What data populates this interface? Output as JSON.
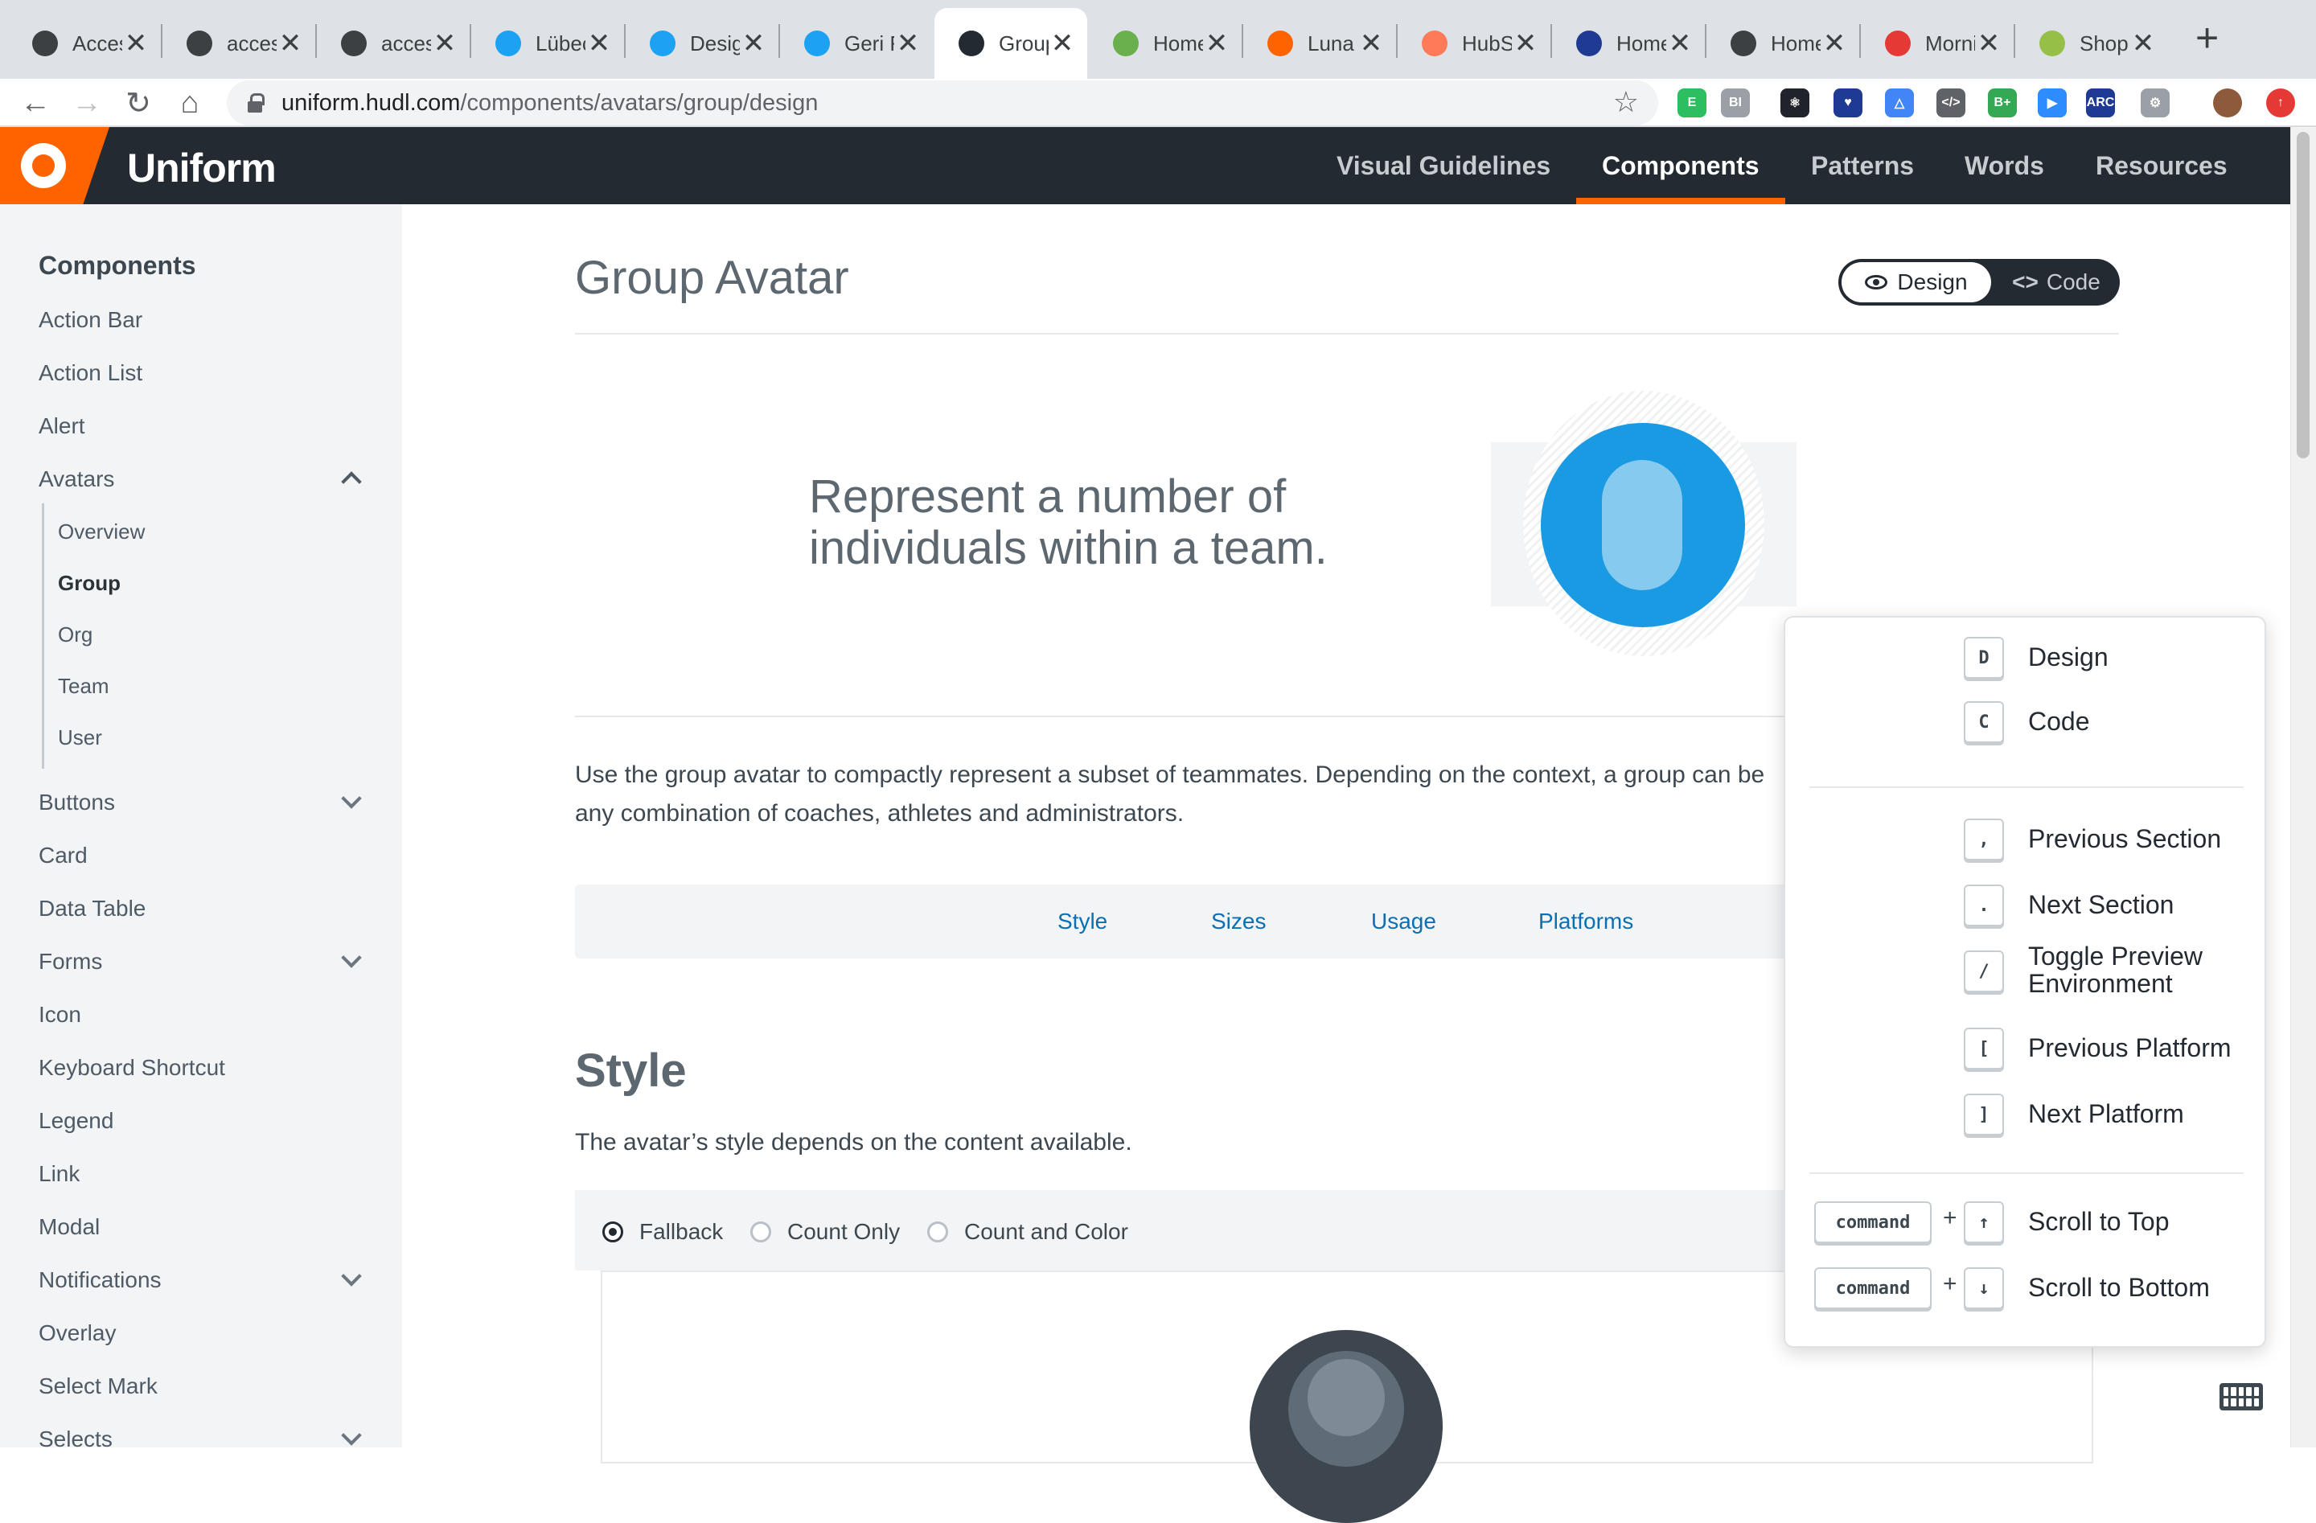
{
  "browser": {
    "tabs": [
      {
        "title": "Accessibility",
        "icon": "globe-icon",
        "color": "#3c4043"
      },
      {
        "title": "accessibility",
        "icon": "globe-icon",
        "color": "#3c4043"
      },
      {
        "title": "accessibility",
        "icon": "globe-icon",
        "color": "#3c4043"
      },
      {
        "title": "Lübeck",
        "icon": "twitter-icon",
        "color": "#1da1f2"
      },
      {
        "title": "Design",
        "icon": "twitter-icon",
        "color": "#1da1f2"
      },
      {
        "title": "Geri R",
        "icon": "twitter-icon",
        "color": "#1da1f2"
      },
      {
        "title": "Group",
        "icon": "uniform-icon",
        "color": "#232a31"
      },
      {
        "title": "Home",
        "icon": "hudl-icon",
        "color": "#6ab04c"
      },
      {
        "title": "Luna",
        "icon": "s-icon",
        "color": "#ff6300"
      },
      {
        "title": "HubSpot",
        "icon": "hubspot-icon",
        "color": "#ff7a59"
      },
      {
        "title": "Home",
        "icon": "a-icon",
        "color": "#1f3a93"
      },
      {
        "title": "Home",
        "icon": "link-icon",
        "color": "#3c4043"
      },
      {
        "title": "Morning",
        "icon": "m-icon",
        "color": "#e53935"
      },
      {
        "title": "Shopify",
        "icon": "shopify-icon",
        "color": "#95bf47"
      }
    ],
    "close_glyph": "✕",
    "new_tab_glyph": "+",
    "url_host": "uniform.hudl.com",
    "url_path": "/components/avatars/group/design",
    "extensions": [
      {
        "name": "evernote-icon",
        "color": "#2dbe60",
        "glyph": "E"
      },
      {
        "name": "bi-icon",
        "color": "#9aa0a6",
        "glyph": "BI"
      },
      {
        "name": "react-icon",
        "color": "#20232a",
        "glyph": "⚛"
      },
      {
        "name": "heart-icon",
        "color": "#1f3a93",
        "glyph": "♥"
      },
      {
        "name": "triangle-icon",
        "color": "#4285f4",
        "glyph": "△"
      },
      {
        "name": "code-icon",
        "color": "#5f6368",
        "glyph": "</>"
      },
      {
        "name": "b-plus-icon",
        "color": "#34a853",
        "glyph": "B+"
      },
      {
        "name": "zoom-icon",
        "color": "#2d8cff",
        "glyph": "▶"
      },
      {
        "name": "arc-icon",
        "color": "#1f3a93",
        "glyph": "ARC"
      },
      {
        "name": "gear-icon",
        "color": "#9aa0a6",
        "glyph": "⚙"
      },
      {
        "name": "profile-avatar",
        "color": "#8d5a3b",
        "glyph": ""
      },
      {
        "name": "update-icon",
        "color": "#e53935",
        "glyph": "↑"
      }
    ]
  },
  "header": {
    "brand": "Uniform",
    "nav": [
      "Visual Guidelines",
      "Components",
      "Patterns",
      "Words",
      "Resources"
    ],
    "active_nav": "Components"
  },
  "sidebar": {
    "title": "Components",
    "items": [
      "Action Bar",
      "Action List",
      "Alert",
      "Avatars",
      "Buttons",
      "Card",
      "Data Table",
      "Forms",
      "Icon",
      "Keyboard Shortcut",
      "Legend",
      "Link",
      "Modal",
      "Notifications",
      "Overlay",
      "Select Mark",
      "Selects"
    ],
    "avatars_sub": [
      "Overview",
      "Group",
      "Org",
      "Team",
      "User"
    ],
    "active_sub": "Group"
  },
  "page": {
    "title": "Group Avatar",
    "toggle_design": "Design",
    "toggle_code": "Code",
    "hero_text": "Represent a number of individuals within a team.",
    "intro": "Use the group avatar to compactly represent a subset of teammates. Depending on the context, a group can be any combination of coaches, athletes and administrators.",
    "subnav": [
      "Style",
      "Sizes",
      "Usage",
      "Platforms"
    ],
    "style_title": "Style",
    "style_desc": "The avatar’s style depends on the content available.",
    "radios": [
      "Fallback",
      "Count Only",
      "Count and Color"
    ],
    "radio_selected": "Fallback"
  },
  "shortcuts": {
    "groups": [
      [
        {
          "keys": [
            "D"
          ],
          "label": "Design"
        },
        {
          "keys": [
            "C"
          ],
          "label": "Code"
        }
      ],
      [
        {
          "keys": [
            ","
          ],
          "label": "Previous Section"
        },
        {
          "keys": [
            "."
          ],
          "label": "Next Section"
        },
        {
          "keys": [
            "/"
          ],
          "label": "Toggle Preview Environment"
        },
        {
          "keys": [
            "["
          ],
          "label": "Previous Platform"
        },
        {
          "keys": [
            "]"
          ],
          "label": "Next Platform"
        }
      ],
      [
        {
          "keys": [
            "command",
            "↑"
          ],
          "label": "Scroll to Top"
        },
        {
          "keys": [
            "command",
            "↓"
          ],
          "label": "Scroll to Bottom"
        }
      ]
    ],
    "plus": "+"
  },
  "colors": {
    "brand_orange": "#ff6300",
    "header_dark": "#232a31",
    "avatar_blue": "#1a9ae3",
    "link_blue": "#0a6fb3"
  }
}
